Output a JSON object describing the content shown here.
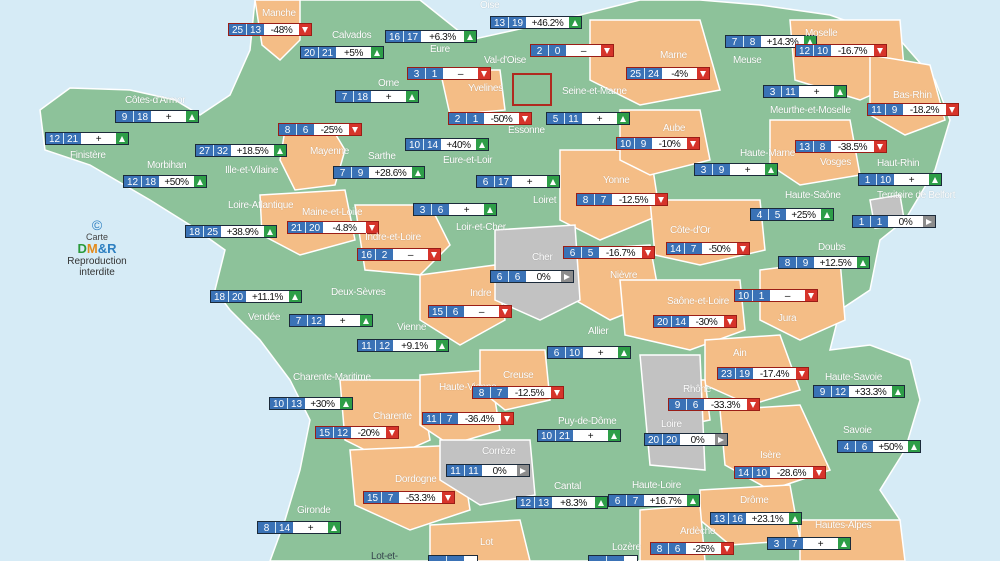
{
  "map": {
    "colors": {
      "sea": "#d6ebf6",
      "green": "#8dc29a",
      "orange": "#f4bd86",
      "gray": "#c2c2c2",
      "border": "#ffffff",
      "counts": "#3a72b6",
      "up": "#2e9e48",
      "down": "#d6342b",
      "flat": "#8c8c8c"
    },
    "logo": {
      "copyright": "©",
      "carte": "Carte",
      "brand_d": "D",
      "brand_m": "M",
      "brand_r": "&R",
      "reproduction": "Reproduction",
      "interdite": "interdite"
    },
    "departments": [
      {
        "name": "Manche",
        "a": "25",
        "b": "13",
        "pct": "-48%",
        "trend": "down"
      },
      {
        "name": "Calvados",
        "a": "20",
        "b": "21",
        "pct": "+5%",
        "trend": "up"
      },
      {
        "name": "Eure",
        "a": "16",
        "b": "17",
        "pct": "+6.3%",
        "trend": "up"
      },
      {
        "name": "Oise",
        "a": "13",
        "b": "19",
        "pct": "+46.2%",
        "trend": "up"
      },
      {
        "name": "Val-d'Oise",
        "a": "2",
        "b": "0",
        "pct": "–",
        "trend": "down"
      },
      {
        "name": "Yvelines",
        "a": "3",
        "b": "1",
        "pct": "–",
        "trend": "down"
      },
      {
        "name": "Essonne",
        "a": "2",
        "b": "1",
        "pct": "-50%",
        "trend": "down"
      },
      {
        "name": "Seine-et-Marne",
        "a": "5",
        "b": "11",
        "pct": "+",
        "trend": "up"
      },
      {
        "name": "Marne",
        "a": "25",
        "b": "24",
        "pct": "-4%",
        "trend": "down"
      },
      {
        "name": "Meuse",
        "a": "7",
        "b": "8",
        "pct": "+14.3%",
        "trend": "up"
      },
      {
        "name": "Moselle",
        "a": "12",
        "b": "10",
        "pct": "-16.7%",
        "trend": "down"
      },
      {
        "name": "Bas-Rhin",
        "a": "11",
        "b": "9",
        "pct": "-18.2%",
        "trend": "down"
      },
      {
        "name": "Meurthe-et-Moselle",
        "a": "3",
        "b": "11",
        "pct": "+",
        "trend": "up"
      },
      {
        "name": "Côtes-d'Armor",
        "a": "9",
        "b": "18",
        "pct": "+",
        "trend": "up"
      },
      {
        "name": "Finistère",
        "a": "12",
        "b": "21",
        "pct": "+",
        "trend": "up"
      },
      {
        "name": "Morbihan",
        "a": "12",
        "b": "18",
        "pct": "+50%",
        "trend": "up"
      },
      {
        "name": "Ille-et-Vilaine",
        "a": "27",
        "b": "32",
        "pct": "+18.5%",
        "trend": "up"
      },
      {
        "name": "Orne",
        "a": "7",
        "b": "18",
        "pct": "+",
        "trend": "up"
      },
      {
        "name": "Mayenne",
        "a": "8",
        "b": "6",
        "pct": "-25%",
        "trend": "down"
      },
      {
        "name": "Sarthe",
        "a": "7",
        "b": "9",
        "pct": "+28.6%",
        "trend": "up"
      },
      {
        "name": "Eure-et-Loir",
        "a": "10",
        "b": "14",
        "pct": "+40%",
        "trend": "up"
      },
      {
        "name": "Aube",
        "a": "10",
        "b": "9",
        "pct": "-10%",
        "trend": "down"
      },
      {
        "name": "Haute-Marne",
        "a": "3",
        "b": "9",
        "pct": "+",
        "trend": "up"
      },
      {
        "name": "Vosges",
        "a": "13",
        "b": "8",
        "pct": "-38.5%",
        "trend": "down"
      },
      {
        "name": "Haut-Rhin",
        "a": "1",
        "b": "10",
        "pct": "+",
        "trend": "up"
      },
      {
        "name": "Loiret",
        "a": "6",
        "b": "17",
        "pct": "+",
        "trend": "up"
      },
      {
        "name": "Yonne",
        "a": "8",
        "b": "7",
        "pct": "-12.5%",
        "trend": "down"
      },
      {
        "name": "Haute-Saône",
        "a": "4",
        "b": "5",
        "pct": "+25%",
        "trend": "up"
      },
      {
        "name": "Territoire de Belfort",
        "a": "1",
        "b": "1",
        "pct": "0%",
        "trend": "flat"
      },
      {
        "name": "Loire-Atlantique",
        "a": "18",
        "b": "25",
        "pct": "+38.9%",
        "trend": "up"
      },
      {
        "name": "Maine-et-Loire",
        "a": "21",
        "b": "20",
        "pct": "-4.8%",
        "trend": "down"
      },
      {
        "name": "Loir-et-Cher",
        "a": "3",
        "b": "6",
        "pct": "+",
        "trend": "up"
      },
      {
        "name": "Indre-et-Loire",
        "a": "16",
        "b": "2",
        "pct": "–",
        "trend": "down"
      },
      {
        "name": "Cher",
        "a": "6",
        "b": "6",
        "pct": "0%",
        "trend": "flat"
      },
      {
        "name": "Nièvre",
        "a": "6",
        "b": "5",
        "pct": "-16.7%",
        "trend": "down"
      },
      {
        "name": "Côte-d'Or",
        "a": "14",
        "b": "7",
        "pct": "-50%",
        "trend": "down"
      },
      {
        "name": "Doubs",
        "a": "8",
        "b": "9",
        "pct": "+12.5%",
        "trend": "up"
      },
      {
        "name": "Vendée",
        "a": "18",
        "b": "20",
        "pct": "+11.1%",
        "trend": "up"
      },
      {
        "name": "Deux-Sèvres",
        "a": "7",
        "b": "12",
        "pct": "+",
        "trend": "up"
      },
      {
        "name": "Indre",
        "a": "15",
        "b": "6",
        "pct": "–",
        "trend": "down"
      },
      {
        "name": "Saône-et-Loire",
        "a": "20",
        "b": "14",
        "pct": "-30%",
        "trend": "down"
      },
      {
        "name": "Jura",
        "a": "10",
        "b": "1",
        "pct": "–",
        "trend": "down"
      },
      {
        "name": "Vienne",
        "a": "11",
        "b": "12",
        "pct": "+9.1%",
        "trend": "up"
      },
      {
        "name": "Allier",
        "a": "6",
        "b": "10",
        "pct": "+",
        "trend": "up"
      },
      {
        "name": "Ain",
        "a": "23",
        "b": "19",
        "pct": "-17.4%",
        "trend": "down"
      },
      {
        "name": "Haute-Savoie",
        "a": "9",
        "b": "12",
        "pct": "+33.3%",
        "trend": "up"
      },
      {
        "name": "Charente-Maritime",
        "a": "10",
        "b": "13",
        "pct": "+30%",
        "trend": "up"
      },
      {
        "name": "Charente",
        "a": "15",
        "b": "12",
        "pct": "-20%",
        "trend": "down"
      },
      {
        "name": "Haute-Vienne",
        "a": "11",
        "b": "7",
        "pct": "-36.4%",
        "trend": "down"
      },
      {
        "name": "Creuse",
        "a": "8",
        "b": "7",
        "pct": "-12.5%",
        "trend": "down"
      },
      {
        "name": "Rhône",
        "a": "9",
        "b": "6",
        "pct": "-33.3%",
        "trend": "down"
      },
      {
        "name": "Puy-de-Dôme",
        "a": "10",
        "b": "21",
        "pct": "+",
        "trend": "up"
      },
      {
        "name": "Loire",
        "a": "20",
        "b": "20",
        "pct": "0%",
        "trend": "flat"
      },
      {
        "name": "Savoie",
        "a": "4",
        "b": "6",
        "pct": "+50%",
        "trend": "up"
      },
      {
        "name": "Corrèze",
        "a": "11",
        "b": "11",
        "pct": "0%",
        "trend": "flat"
      },
      {
        "name": "Isère",
        "a": "14",
        "b": "10",
        "pct": "-28.6%",
        "trend": "down"
      },
      {
        "name": "Dordogne",
        "a": "15",
        "b": "7",
        "pct": "-53.3%",
        "trend": "down"
      },
      {
        "name": "Cantal",
        "a": "12",
        "b": "13",
        "pct": "+8.3%",
        "trend": "up"
      },
      {
        "name": "Haute-Loire",
        "a": "6",
        "b": "7",
        "pct": "+16.7%",
        "trend": "up"
      },
      {
        "name": "Drôme",
        "a": "13",
        "b": "16",
        "pct": "+23.1%",
        "trend": "up"
      },
      {
        "name": "Gironde",
        "a": "8",
        "b": "14",
        "pct": "+",
        "trend": "up"
      },
      {
        "name": "Ardèche",
        "a": "8",
        "b": "6",
        "pct": "-25%",
        "trend": "down"
      },
      {
        "name": "Hautes-Alpes",
        "a": "3",
        "b": "7",
        "pct": "+",
        "trend": "up"
      },
      {
        "name": "Lot",
        "a": "",
        "b": "",
        "pct": "",
        "trend": ""
      },
      {
        "name": "Lot-et-",
        "a": "",
        "b": "",
        "pct": "",
        "trend": ""
      },
      {
        "name": "Lozère",
        "a": "",
        "b": "",
        "pct": "",
        "trend": ""
      }
    ]
  }
}
